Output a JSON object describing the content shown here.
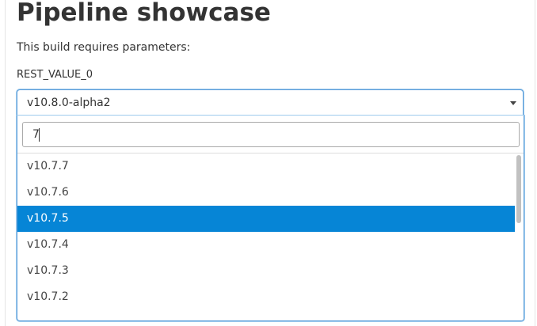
{
  "page": {
    "title": "Pipeline showcase",
    "intro": "This build requires parameters:"
  },
  "parameter": {
    "name": "REST_VALUE_0",
    "selected_value": "v10.8.0-alpha2"
  },
  "dropdown": {
    "search_value": "7",
    "results": [
      {
        "label": "v10.7.7",
        "highlighted": false
      },
      {
        "label": "v10.7.6",
        "highlighted": false
      },
      {
        "label": "v10.7.5",
        "highlighted": true
      },
      {
        "label": "v10.7.4",
        "highlighted": false
      },
      {
        "label": "v10.7.3",
        "highlighted": false
      },
      {
        "label": "v10.7.2",
        "highlighted": false
      },
      {
        "label": "",
        "highlighted": false
      }
    ]
  },
  "colors": {
    "highlight": "#0685d6",
    "focus_border": "#5b9dd9",
    "text": "#333333"
  },
  "icons": {
    "select_caret": "chevron-down-icon"
  }
}
